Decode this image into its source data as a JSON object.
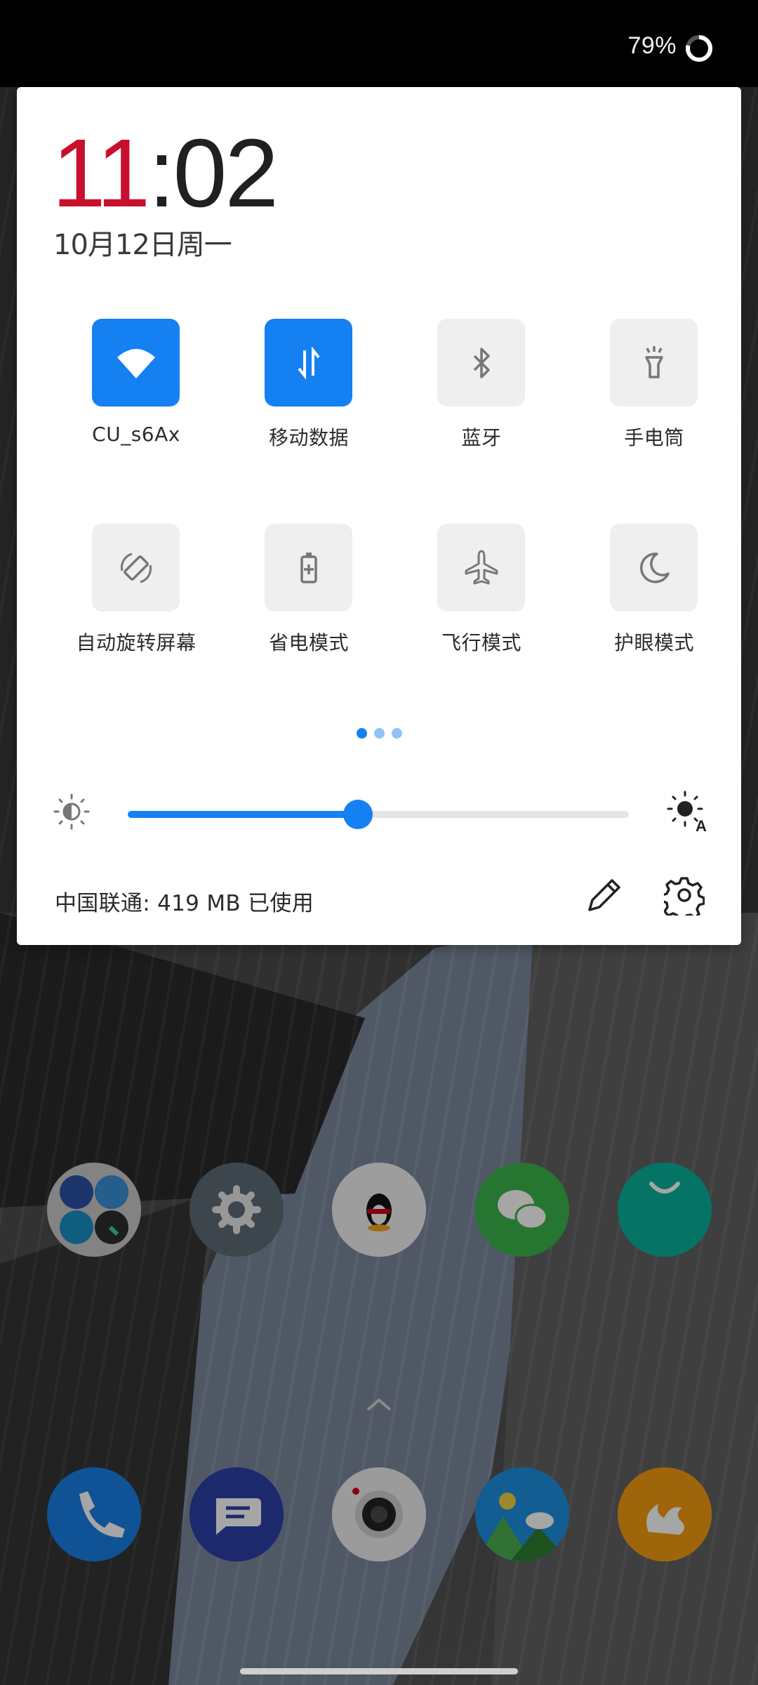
{
  "status_bar": {
    "battery_percent_text": "79%",
    "battery_level": 0.79
  },
  "quick_settings": {
    "time_hour": "11",
    "time_minute": "02",
    "date": "10月12日周一",
    "tiles": [
      {
        "label": "CU_s6Ax",
        "icon": "wifi-icon",
        "active": true
      },
      {
        "label": "移动数据",
        "icon": "mobile-data-icon",
        "active": true
      },
      {
        "label": "蓝牙",
        "icon": "bluetooth-icon",
        "active": false
      },
      {
        "label": "手电筒",
        "icon": "flashlight-icon",
        "active": false
      },
      {
        "label": "自动旋转屏幕",
        "icon": "auto-rotate-icon",
        "active": false
      },
      {
        "label": "省电模式",
        "icon": "battery-saver-icon",
        "active": false
      },
      {
        "label": "飞行模式",
        "icon": "airplane-icon",
        "active": false
      },
      {
        "label": "护眼模式",
        "icon": "eye-comfort-icon",
        "active": false
      }
    ],
    "pager": {
      "pages": 3,
      "current": 1
    },
    "brightness": {
      "level": 0.46
    },
    "data_usage": "中国联通: 419 MB 已使用"
  },
  "home_screen": {
    "row1_icons": [
      "app-folder-icon",
      "settings-app-icon",
      "qq-app-icon",
      "wechat-app-icon",
      "store-app-icon"
    ],
    "dock_icons": [
      "phone-app-icon",
      "messages-app-icon",
      "camera-app-icon",
      "gallery-app-icon",
      "uc-browser-app-icon"
    ]
  },
  "colors": {
    "accent": "#1580f2",
    "clock_hour": "#c8102e",
    "tile_inactive": "#efefef",
    "icon_inactive": "#777777"
  }
}
